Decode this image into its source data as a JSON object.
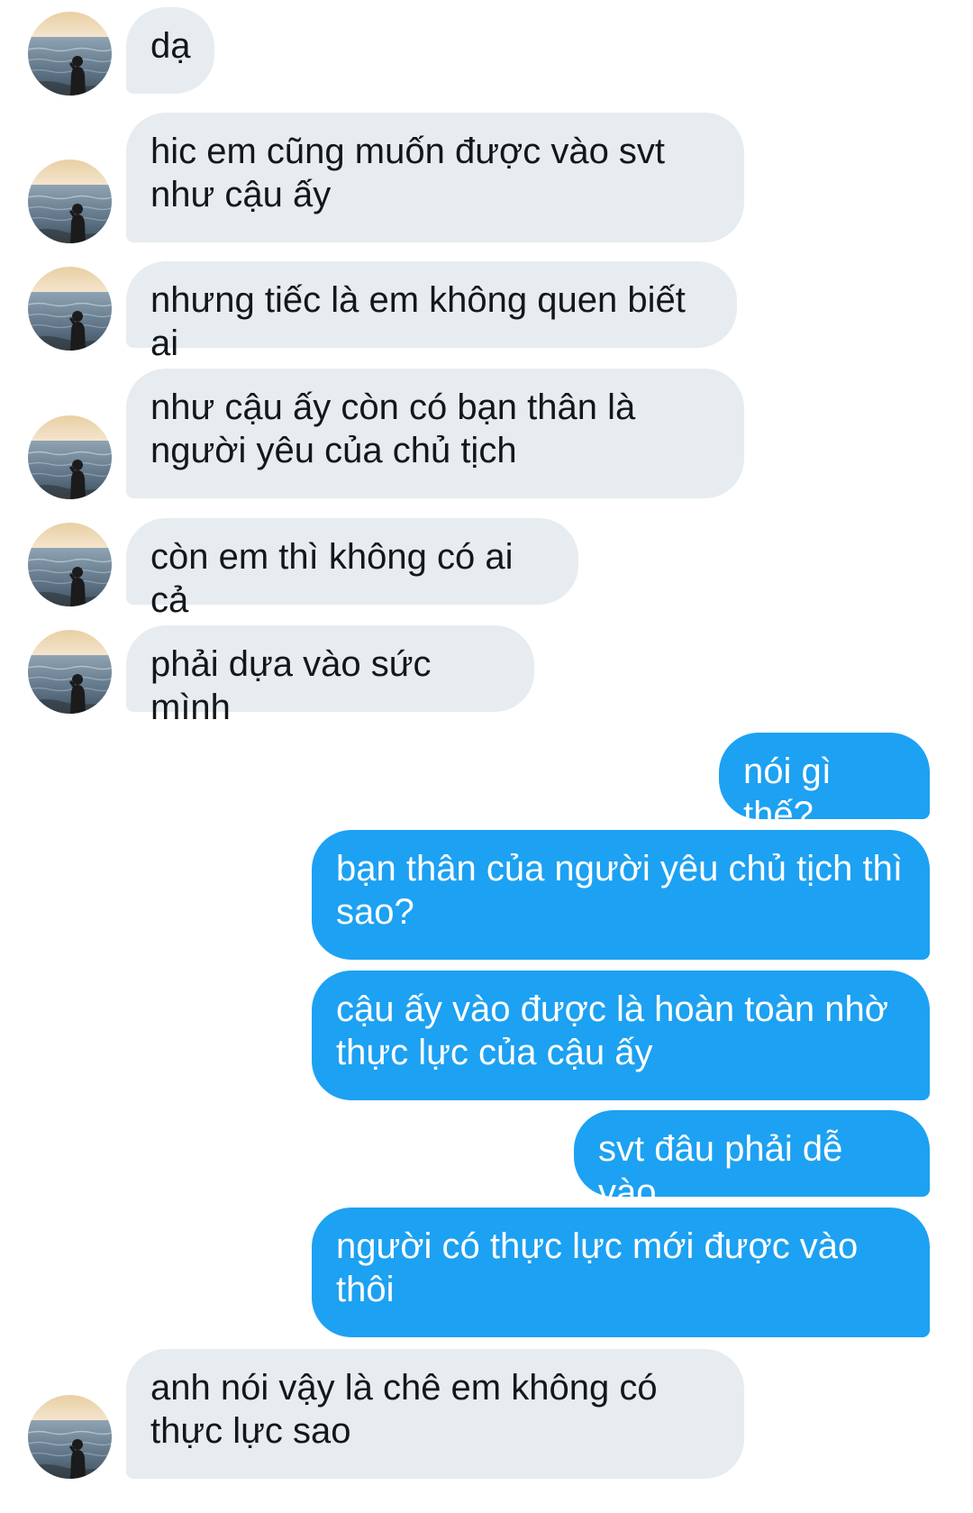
{
  "conversation": {
    "messages": [
      {
        "side": "in",
        "text": "dạ"
      },
      {
        "side": "in",
        "text": "hic em cũng muốn được vào svt như cậu ấy"
      },
      {
        "side": "in",
        "text": "nhưng tiếc là em không quen biết ai"
      },
      {
        "side": "in",
        "text": "như cậu ấy còn có bạn thân là người yêu của chủ tịch"
      },
      {
        "side": "in",
        "text": "còn em thì không có ai cả"
      },
      {
        "side": "in",
        "text": "phải dựa vào sức mình"
      },
      {
        "side": "out",
        "text": "nói gì thế?"
      },
      {
        "side": "out",
        "text": "bạn thân của người yêu chủ tịch thì sao?"
      },
      {
        "side": "out",
        "text": "cậu ấy vào được là hoàn toàn nhờ thực lực của cậu ấy"
      },
      {
        "side": "out",
        "text": "svt đâu phải dễ vào"
      },
      {
        "side": "out",
        "text": "người có thực lực mới được vào thôi"
      },
      {
        "side": "in",
        "text": "anh nói vậy là chê em không có thực lực sao"
      }
    ]
  },
  "colors": {
    "incoming_bubble": "#e6ecf0",
    "incoming_text": "#14171a",
    "outgoing_bubble": "#1da1f2",
    "outgoing_text": "#ffffff"
  },
  "avatar": {
    "icon": "sunset-sea-silhouette-avatar"
  }
}
